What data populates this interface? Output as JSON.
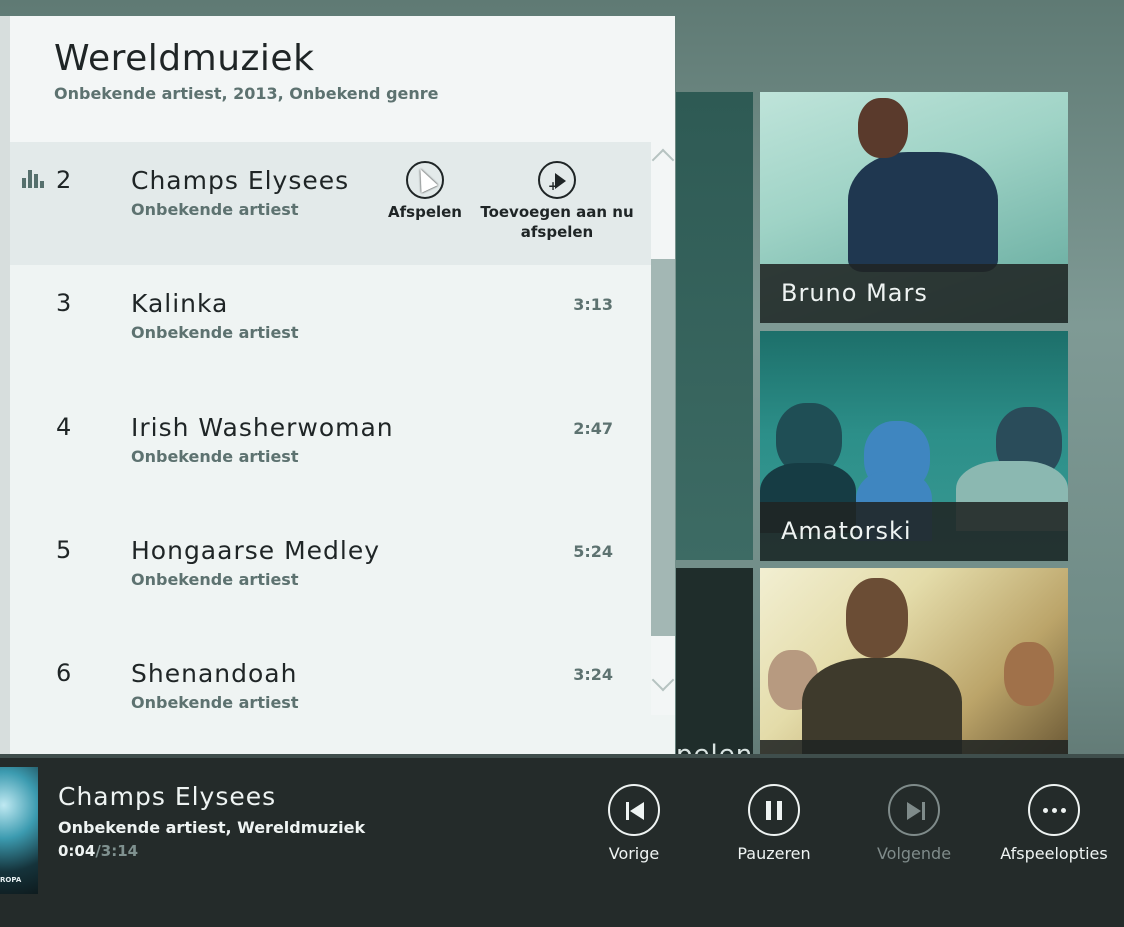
{
  "album": {
    "title": "Wereldmuziek",
    "subtitle": "Onbekende artiest, 2013, Onbekend genre"
  },
  "tracks": [
    {
      "num": "2",
      "title": "Champs Elysees",
      "artist": "Onbekende artiest",
      "duration": "",
      "selected": true
    },
    {
      "num": "3",
      "title": "Kalinka",
      "artist": "Onbekende artiest",
      "duration": "3:13"
    },
    {
      "num": "4",
      "title": "Irish Washerwoman",
      "artist": "Onbekende artiest",
      "duration": "2:47"
    },
    {
      "num": "5",
      "title": "Hongaarse Medley",
      "artist": "Onbekende artiest",
      "duration": "5:24"
    },
    {
      "num": "6",
      "title": "Shenandoah",
      "artist": "Onbekende artiest",
      "duration": "3:24"
    }
  ],
  "row_actions": {
    "play_label": "Afspelen",
    "add_label_line1": "Toevoegen aan nu",
    "add_label_line2": "afspelen"
  },
  "artist_tiles": [
    {
      "name": "Bruno Mars"
    },
    {
      "name": "Amatorski"
    },
    {
      "name": ""
    }
  ],
  "background_partial_text": "pelen",
  "now_playing": {
    "title": "Champs Elysees",
    "subtitle": "Onbekende artiest, Wereldmuziek",
    "current_time": "0:04",
    "total_time": "/3:14",
    "cover_text": "ROPA"
  },
  "controls": {
    "prev_label": "Vorige",
    "pause_label": "Pauzeren",
    "next_label": "Volgende",
    "options_label": "Afspeelopties"
  },
  "icons": {
    "now_playing_indicator": "equalizer-icon",
    "play": "play-icon",
    "add_to_now_playing": "add-play-icon",
    "previous": "previous-icon",
    "pause": "pause-icon",
    "next": "next-icon",
    "more": "more-icon"
  },
  "colors": {
    "panel_bg": "#eff4f3",
    "selected_row": "#e3eaea",
    "player_bg": "#242b2a",
    "secondary_text": "#5d7270"
  }
}
